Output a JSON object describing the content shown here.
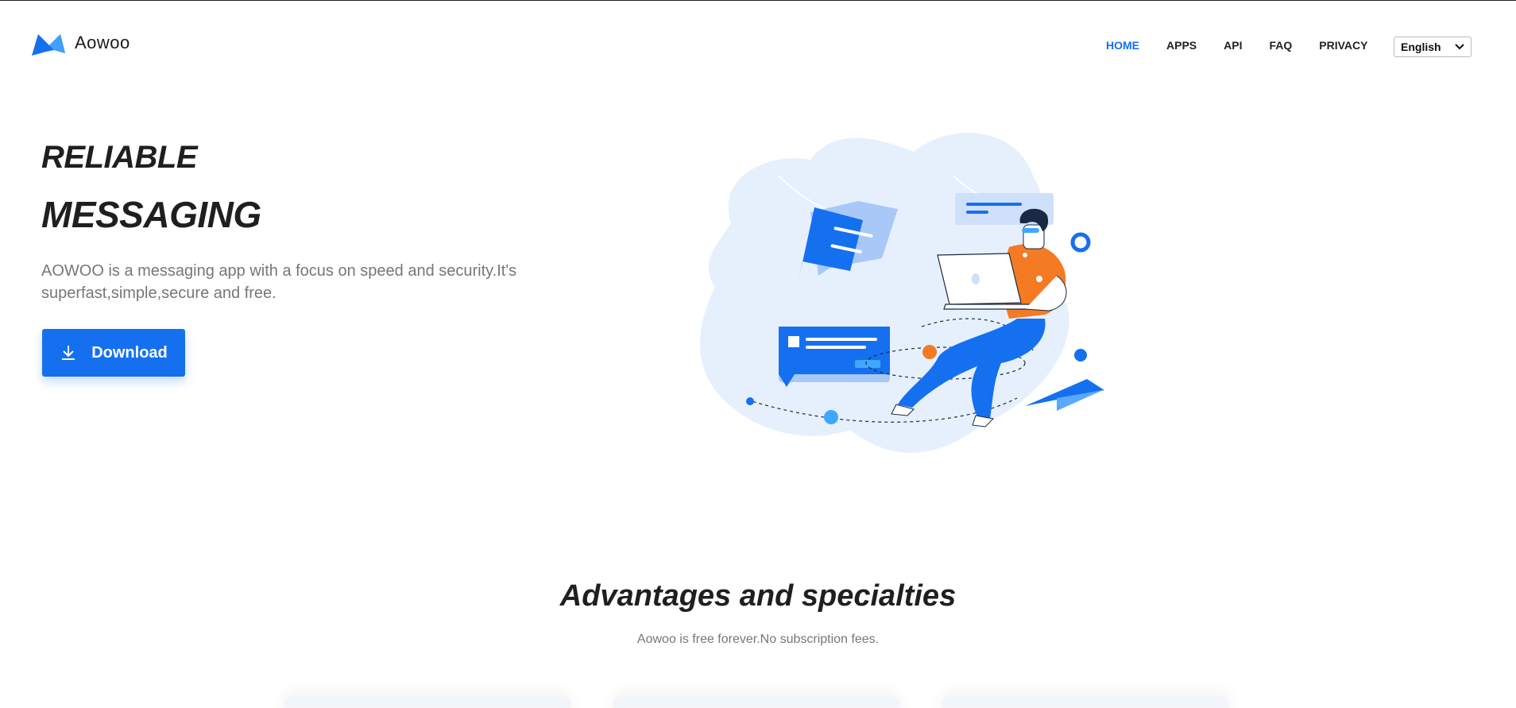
{
  "header": {
    "logo_text": "Aowoo",
    "nav": [
      {
        "label": "HOME",
        "active": true
      },
      {
        "label": "APPS",
        "active": false
      },
      {
        "label": "API",
        "active": false
      },
      {
        "label": "FAQ",
        "active": false
      },
      {
        "label": "PRIVACY",
        "active": false
      }
    ],
    "language": {
      "selected": "English"
    }
  },
  "hero": {
    "title_line1": "RELIABLE",
    "title_line2": "MESSAGING",
    "description": "AOWOO is a messaging app with a focus on speed and security.It's superfast,simple,secure and free.",
    "download_label": "Download"
  },
  "advantages": {
    "title": "Advantages and specialties",
    "subtitle": "Aowoo is free forever.No subscription fees."
  },
  "colors": {
    "accent": "#1570f0",
    "nav_active": "#1270f0",
    "text_dark": "#1f1f1f",
    "text_muted": "#777777",
    "illustration_bg": "#e6f0fd",
    "illustration_orange": "#f47a24"
  }
}
